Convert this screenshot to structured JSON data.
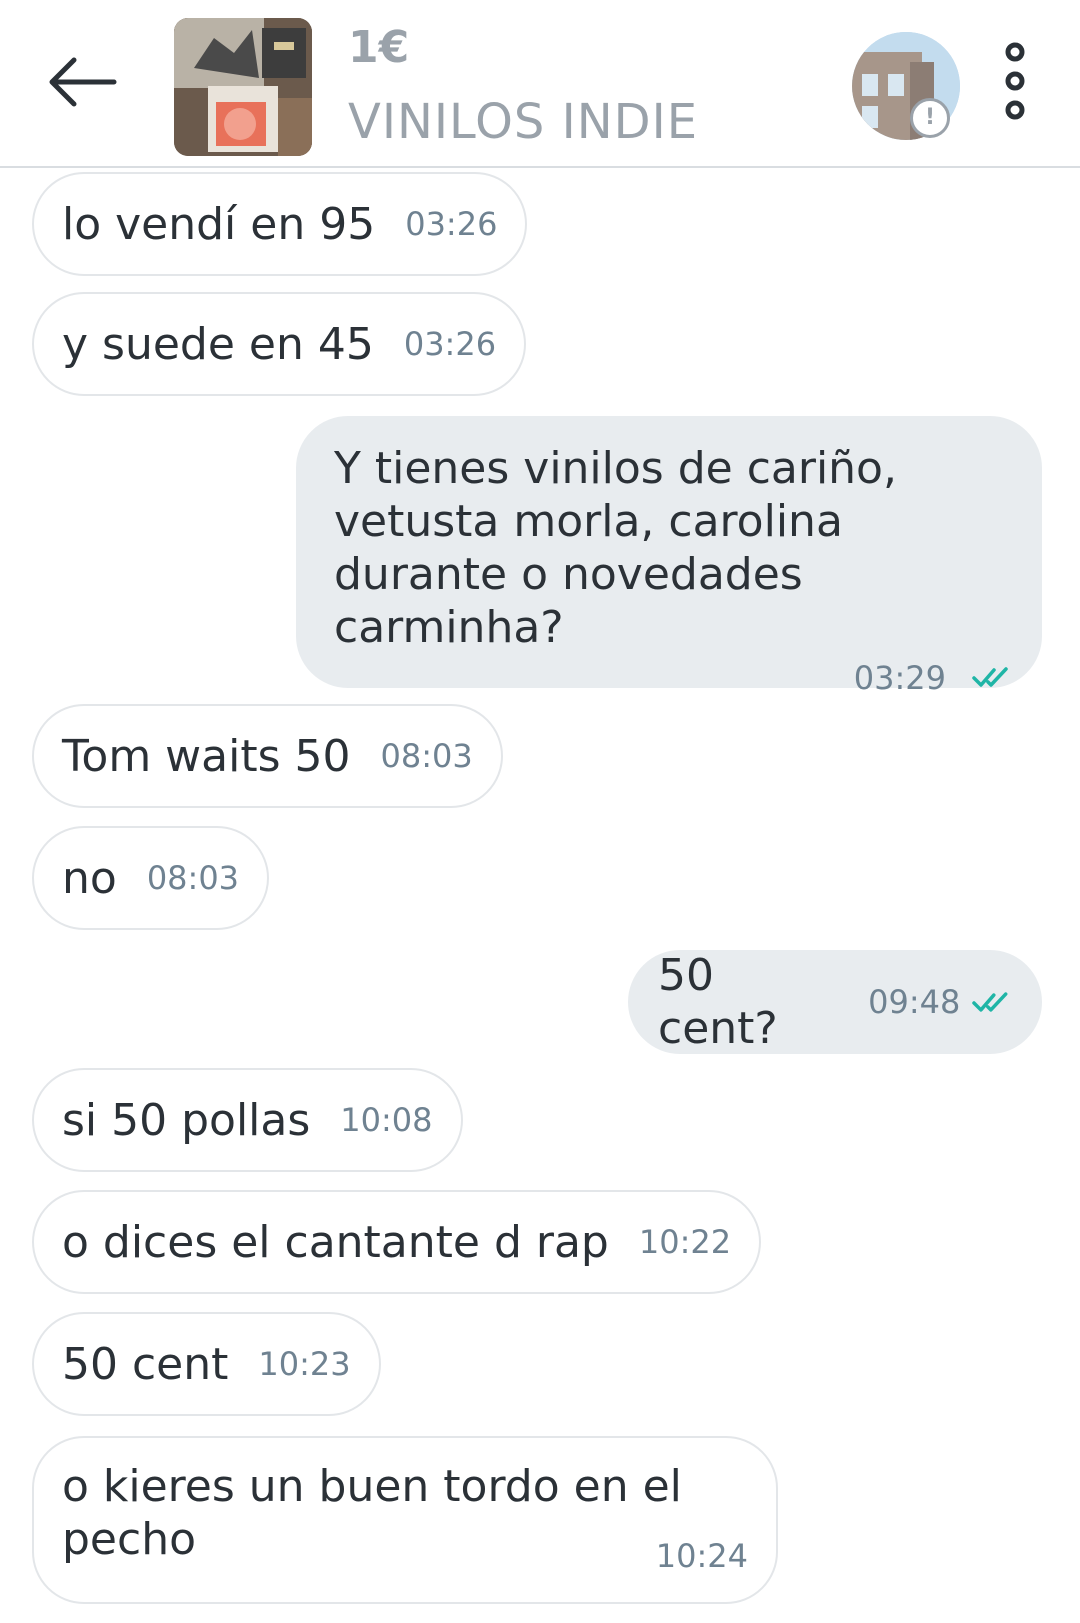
{
  "header": {
    "price": "1€",
    "title": "VINILOS INDIE",
    "back_icon": "arrow-left-icon",
    "more_icon": "more-vertical-icon",
    "badge_icon": "exclamation-circle-icon",
    "badge_text": "!"
  },
  "messages": [
    {
      "direction": "incoming",
      "text": "lo vendí en 95",
      "time": "03:26"
    },
    {
      "direction": "incoming",
      "text": "y suede en 45",
      "time": "03:26"
    },
    {
      "direction": "outgoing",
      "text": "Y tienes vinilos de cariño,\nvetusta morla, carolina\ndurante o novedades\ncarminha?",
      "time": "03:29",
      "status": "read"
    },
    {
      "direction": "incoming",
      "text": "Tom waits 50",
      "time": "08:03"
    },
    {
      "direction": "incoming",
      "text": "no",
      "time": "08:03"
    },
    {
      "direction": "outgoing",
      "text": "50 cent?",
      "time": "09:48",
      "status": "read"
    },
    {
      "direction": "incoming",
      "text": "si 50 pollas",
      "time": "10:08"
    },
    {
      "direction": "incoming",
      "text": "o dices el cantante d rap",
      "time": "10:22"
    },
    {
      "direction": "incoming",
      "text": "50 cent",
      "time": "10:23"
    },
    {
      "direction": "incoming",
      "text": "o kieres un buen tordo en el\npecho",
      "time": "10:24"
    }
  ],
  "colors": {
    "read_ticks": "#1fb5a6",
    "outgoing_bubble": "#e8ecef",
    "incoming_border": "#e3e6e9",
    "timestamp": "#6f8291",
    "header_text": "#9aa2aa"
  }
}
